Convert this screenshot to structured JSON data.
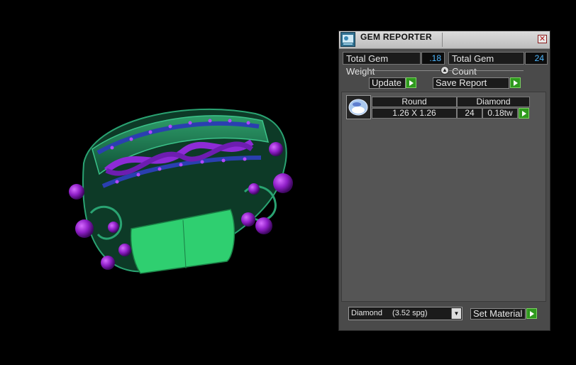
{
  "panel": {
    "title": "GEM REPORTER",
    "close_glyph": "✕",
    "title_icon": "gem-reporter-app-icon"
  },
  "totals": {
    "weight_label": "Total Gem Weight",
    "weight_value": ".18",
    "count_label": "Total Gem Count",
    "count_value": "24"
  },
  "collapse_glyph": "▲",
  "actions": {
    "update_label": "Update",
    "save_report_label": "Save Report"
  },
  "report": {
    "rows": [
      {
        "shape": "Round",
        "material": "Diamond",
        "size": "1.26 X 1.26",
        "count": "24",
        "weight": "0.18tw",
        "thumb_icon": "round-gem-icon"
      }
    ]
  },
  "material_select": {
    "selected_name": "Diamond",
    "selected_spg": "(3.52 spg)",
    "arrow_glyph": "▼"
  },
  "set_material_label": "Set Material",
  "colors": {
    "accent_value": "#4fb8ff",
    "play_green": "#2f9a1e",
    "ring_green": "#1f8a5c",
    "gem_purple": "#9a2ad0"
  }
}
